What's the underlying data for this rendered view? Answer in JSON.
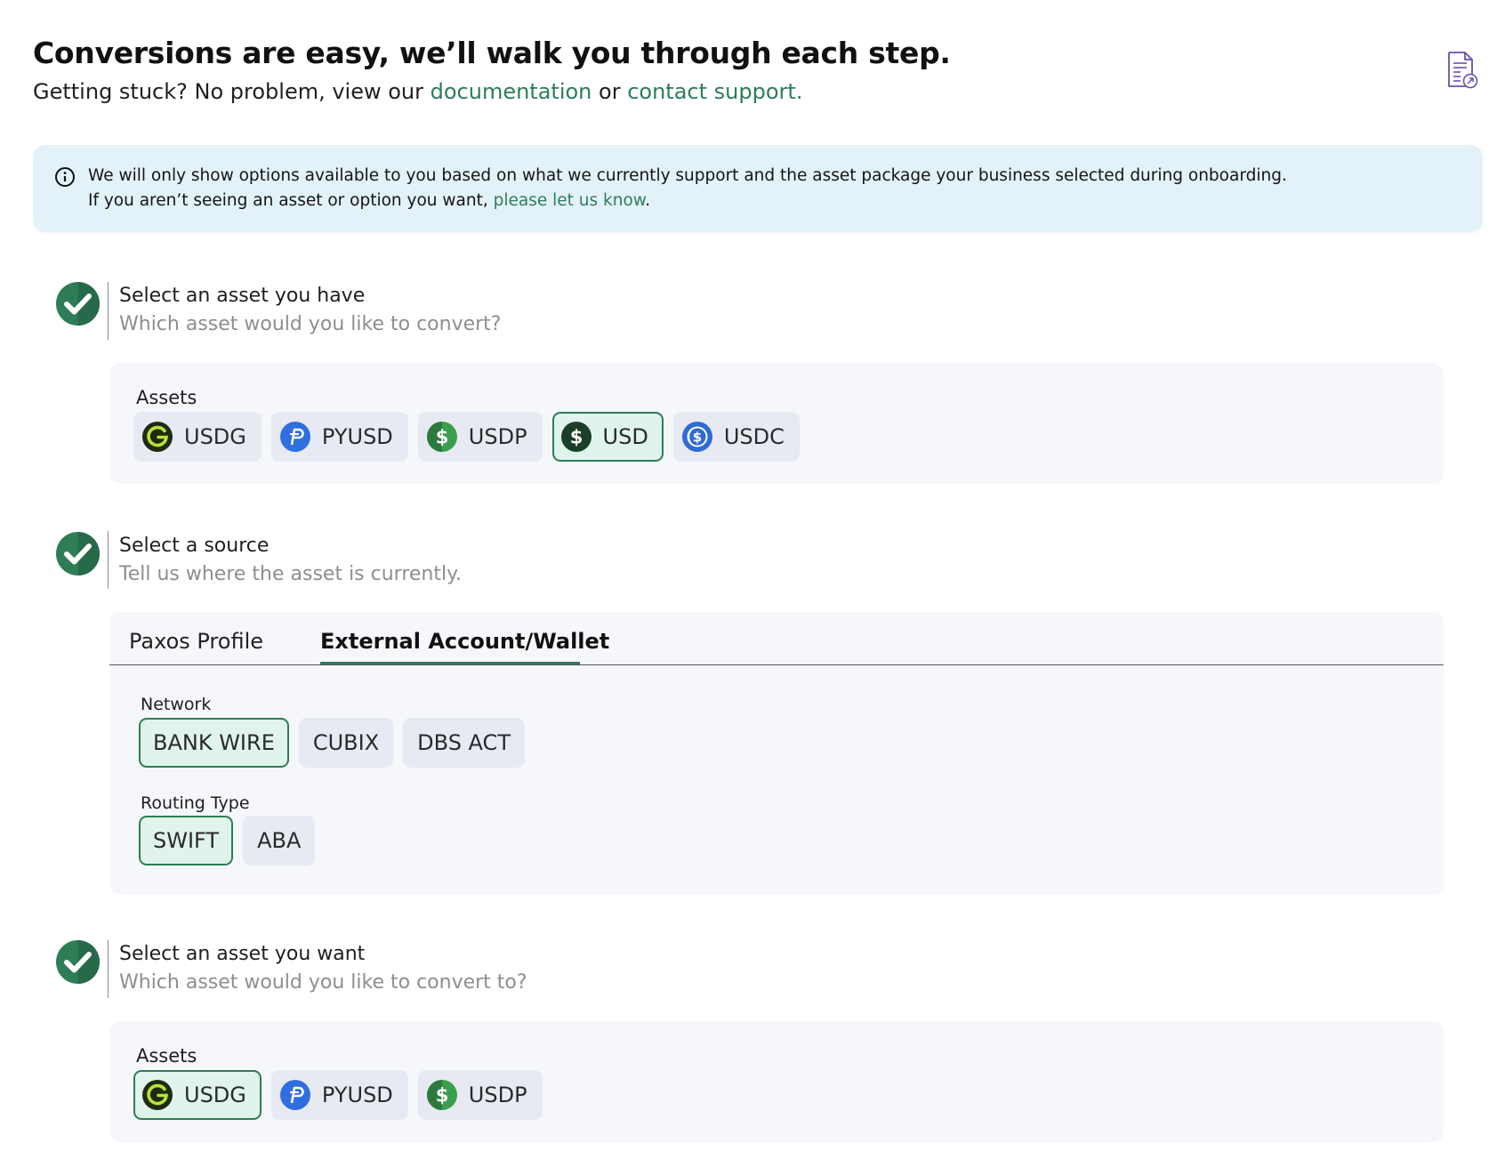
{
  "header": {
    "title": "Conversions are easy, we’ll walk you through each step.",
    "subtitle_prefix": "Getting stuck? No problem, view our ",
    "documentation_link": "documentation",
    "subtitle_or": " or ",
    "support_link": "contact support."
  },
  "banner": {
    "line1": "We will only show options available to you based on what we currently support and the asset package your business selected during onboarding.",
    "line2_prefix": "If you aren’t seeing an asset or option you want, ",
    "line2_link": "please let us know",
    "line2_suffix": "."
  },
  "steps": [
    {
      "title": "Select an asset you have",
      "description": "Which asset would you like to convert?",
      "assets_label": "Assets",
      "assets": [
        {
          "label": "USDG",
          "icon": "usdg-icon",
          "selected": false
        },
        {
          "label": "PYUSD",
          "icon": "pyusd-icon",
          "selected": false
        },
        {
          "label": "USDP",
          "icon": "usdp-icon",
          "selected": false
        },
        {
          "label": "USD",
          "icon": "usd-icon",
          "selected": true
        },
        {
          "label": "USDC",
          "icon": "usdc-icon",
          "selected": false
        }
      ]
    },
    {
      "title": "Select a source",
      "description": "Tell us where the asset is currently.",
      "tabs": [
        {
          "label": "Paxos Profile",
          "active": false
        },
        {
          "label": "External Account/Wallet",
          "active": true
        }
      ],
      "network_label": "Network",
      "networks": [
        {
          "label": "BANK WIRE",
          "selected": true
        },
        {
          "label": "CUBIX",
          "selected": false
        },
        {
          "label": "DBS ACT",
          "selected": false
        }
      ],
      "routing_label": "Routing Type",
      "routing_types": [
        {
          "label": "SWIFT",
          "selected": true
        },
        {
          "label": "ABA",
          "selected": false
        }
      ]
    },
    {
      "title": "Select an asset you want",
      "description": "Which asset would you like to convert to?",
      "assets_label": "Assets",
      "assets": [
        {
          "label": "USDG",
          "icon": "usdg-icon",
          "selected": true
        },
        {
          "label": "PYUSD",
          "icon": "pyusd-icon",
          "selected": false
        },
        {
          "label": "USDP",
          "icon": "usdp-icon",
          "selected": false
        }
      ]
    }
  ],
  "colors": {
    "accent": "#2e7d57",
    "banner_bg": "#e3f1f8",
    "panel_bg": "#f5f7fb",
    "chip_bg": "#e7eaf2",
    "chip_selected_bg": "#e0f3ec"
  }
}
